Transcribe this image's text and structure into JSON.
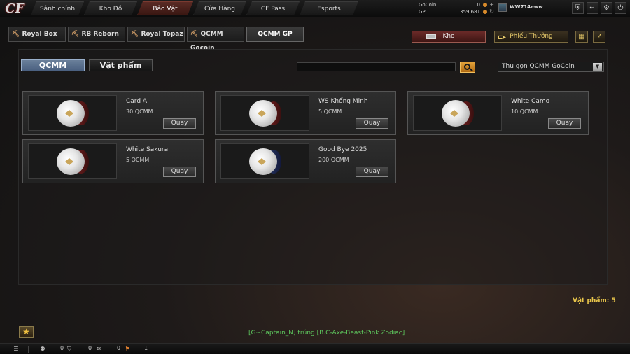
{
  "nav": {
    "tabs": [
      {
        "label": "Sảnh chính"
      },
      {
        "label": "Kho Đồ"
      },
      {
        "label": "Bảo Vật"
      },
      {
        "label": "Cửa Hàng"
      },
      {
        "label": "CF Pass"
      },
      {
        "label": "Esports"
      }
    ]
  },
  "account": {
    "gocoin_label": "GoCoin",
    "gocoin_value": "0",
    "gp_label": "GP",
    "gp_value": "359,681",
    "username": "WW714eww"
  },
  "subtabs": [
    {
      "label": "Royal Box"
    },
    {
      "label": "RB Reborn"
    },
    {
      "label": "Royal Topaz"
    },
    {
      "label": "QCMM Gocoin"
    },
    {
      "label": "QCMM GP"
    }
  ],
  "actions": {
    "kho_label": "Kho",
    "phieu_label": "Phiếu Thưởng"
  },
  "filters": {
    "active_pill": "QCMM",
    "inactive_pill": "Vật phẩm",
    "search_value": "",
    "dropdown_value": "Thu gọn QCMM GoCoin"
  },
  "cards": [
    {
      "name": "Card A",
      "price": "30 QCMM",
      "button": "Quay",
      "color": "#7a2020"
    },
    {
      "name": "WS Khổng Minh",
      "price": "5 QCMM",
      "button": "Quay",
      "color": "#7a2020"
    },
    {
      "name": "White Camo",
      "price": "10 QCMM",
      "button": "Quay",
      "color": "#7a2020"
    },
    {
      "name": "White Sakura",
      "price": "5 QCMM",
      "button": "Quay",
      "color": "#7a2020"
    },
    {
      "name": "Good Bye 2025",
      "price": "200 QCMM",
      "button": "Quay",
      "color": "#2a3a6a"
    }
  ],
  "footer": {
    "item_count": "Vật phẩm: 5",
    "ticker": "[G~Captain_N] trúng [B.C-Axe-Beast-Pink Zodiac]",
    "status": {
      "a": "0",
      "b": "0",
      "c": "0",
      "d": "1"
    }
  }
}
